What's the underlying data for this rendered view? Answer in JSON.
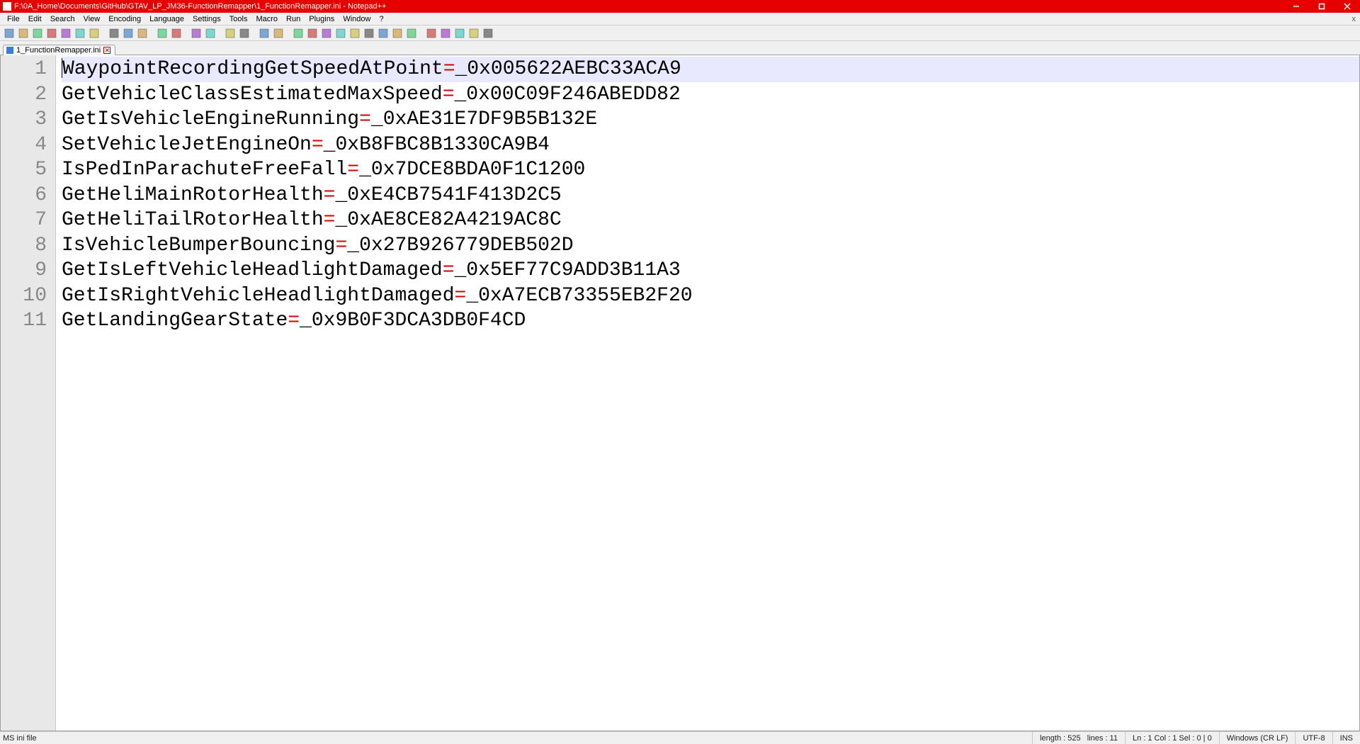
{
  "window": {
    "title": "F:\\0A_Home\\Documents\\GitHub\\GTAV_LP_JM36-FunctionRemapper\\1_FunctionRemapper.ini - Notepad++"
  },
  "menu": {
    "items": [
      "File",
      "Edit",
      "Search",
      "View",
      "Encoding",
      "Language",
      "Settings",
      "Tools",
      "Macro",
      "Run",
      "Plugins",
      "Window",
      "?"
    ]
  },
  "tab": {
    "filename": "1_FunctionRemapper.ini"
  },
  "editor": {
    "lines": [
      {
        "num": "1",
        "key": "WaypointRecordingGetSpeedAtPoint",
        "val": "_0x005622AEBC33ACA9",
        "current": true
      },
      {
        "num": "2",
        "key": "GetVehicleClassEstimatedMaxSpeed",
        "val": "_0x00C09F246ABEDD82"
      },
      {
        "num": "3",
        "key": "GetIsVehicleEngineRunning",
        "val": "_0xAE31E7DF9B5B132E"
      },
      {
        "num": "4",
        "key": "SetVehicleJetEngineOn",
        "val": "_0xB8FBC8B1330CA9B4"
      },
      {
        "num": "5",
        "key": "IsPedInParachuteFreeFall",
        "val": "_0x7DCE8BDA0F1C1200"
      },
      {
        "num": "6",
        "key": "GetHeliMainRotorHealth",
        "val": "_0xE4CB7541F413D2C5"
      },
      {
        "num": "7",
        "key": "GetHeliTailRotorHealth",
        "val": "_0xAE8CE82A4219AC8C"
      },
      {
        "num": "8",
        "key": "IsVehicleBumperBouncing",
        "val": "_0x27B926779DEB502D"
      },
      {
        "num": "9",
        "key": "GetIsLeftVehicleHeadlightDamaged",
        "val": "_0x5EF77C9ADD3B11A3"
      },
      {
        "num": "10",
        "key": "GetIsRightVehicleHeadlightDamaged",
        "val": "_0xA7ECB73355EB2F20"
      },
      {
        "num": "11",
        "key": "GetLandingGearState",
        "val": "_0x9B0F3DCA3DB0F4CD"
      }
    ]
  },
  "status": {
    "filetype": "MS ini file",
    "length_label": "length : 525",
    "lines_label": "lines : 11",
    "pos_label": "Ln : 1    Col : 1    Sel : 0 | 0",
    "eol": "Windows (CR LF)",
    "encoding": "UTF-8",
    "mode": "INS"
  },
  "toolbar_icons": [
    "new-file-icon",
    "open-file-icon",
    "save-icon",
    "save-all-icon",
    "close-icon",
    "close-all-icon",
    "print-icon",
    "sep",
    "cut-icon",
    "copy-icon",
    "paste-icon",
    "sep",
    "undo-icon",
    "redo-icon",
    "sep",
    "find-icon",
    "replace-icon",
    "sep",
    "zoom-in-icon",
    "zoom-out-icon",
    "sep",
    "sync-v-icon",
    "sync-h-icon",
    "sep",
    "wordwrap-icon",
    "allchars-icon",
    "indent-guide-icon",
    "udf-icon",
    "doc-map-icon",
    "doc-list-icon",
    "func-list-icon",
    "folder-icon",
    "monitor-icon",
    "sep",
    "record-icon",
    "stop-icon",
    "play-icon",
    "play-multi-icon",
    "save-macro-icon"
  ]
}
